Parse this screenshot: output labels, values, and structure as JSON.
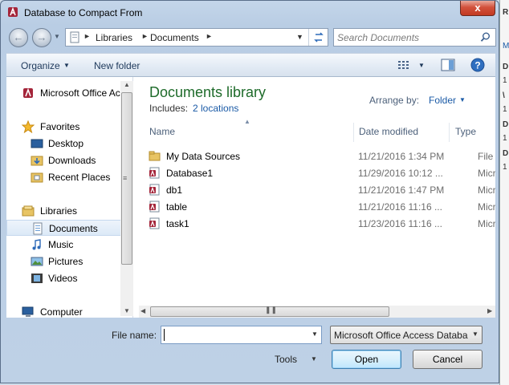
{
  "window": {
    "title": "Database to Compact From",
    "close_glyph": "x"
  },
  "nav": {
    "back_icon": "back-arrow-icon",
    "forward_icon": "forward-arrow-icon",
    "breadcrumb": [
      "Libraries",
      "Documents"
    ],
    "search_placeholder": "Search Documents"
  },
  "toolbar": {
    "organize_label": "Organize",
    "new_folder_label": "New folder"
  },
  "sidebar": {
    "top_item": "Microsoft Office Ac",
    "favorites_header": "Favorites",
    "favorites": [
      "Desktop",
      "Downloads",
      "Recent Places"
    ],
    "libraries_header": "Libraries",
    "libraries": [
      "Documents",
      "Music",
      "Pictures",
      "Videos"
    ],
    "computer_label": "Computer",
    "selected": "Documents"
  },
  "library": {
    "title": "Documents library",
    "includes_label": "Includes:",
    "includes_link": "2 locations",
    "arrange_label": "Arrange by:",
    "arrange_value": "Folder"
  },
  "columns": [
    "Name",
    "Date modified",
    "Type"
  ],
  "files": [
    {
      "name": "My Data Sources",
      "date": "11/21/2016 1:34 PM",
      "type": "File folder",
      "kind": "folder"
    },
    {
      "name": "Database1",
      "date": "11/29/2016 10:12 ...",
      "type": "Microsoft",
      "kind": "access"
    },
    {
      "name": "db1",
      "date": "11/21/2016 1:47 PM",
      "type": "Microsoft",
      "kind": "access"
    },
    {
      "name": "table",
      "date": "11/21/2016 11:16 ...",
      "type": "Microsoft",
      "kind": "access"
    },
    {
      "name": "task1",
      "date": "11/23/2016 11:16 ...",
      "type": "Microsoft",
      "kind": "access"
    }
  ],
  "bottom": {
    "file_name_label": "File name:",
    "file_name_value": "",
    "filter_value": "Microsoft Office Access Databa",
    "tools_label": "Tools",
    "open_label": "Open",
    "cancel_label": "Cancel"
  },
  "edge_strip": [
    "R",
    "M",
    "D",
    "1",
    "\\",
    "1",
    "D",
    "1",
    "D",
    "1"
  ],
  "colors": {
    "title_bar": "#c4d6ea",
    "close_button": "#d2513c",
    "library_title": "#1e6b2a",
    "link": "#1a5aa6",
    "selection": "#dce9f7"
  }
}
